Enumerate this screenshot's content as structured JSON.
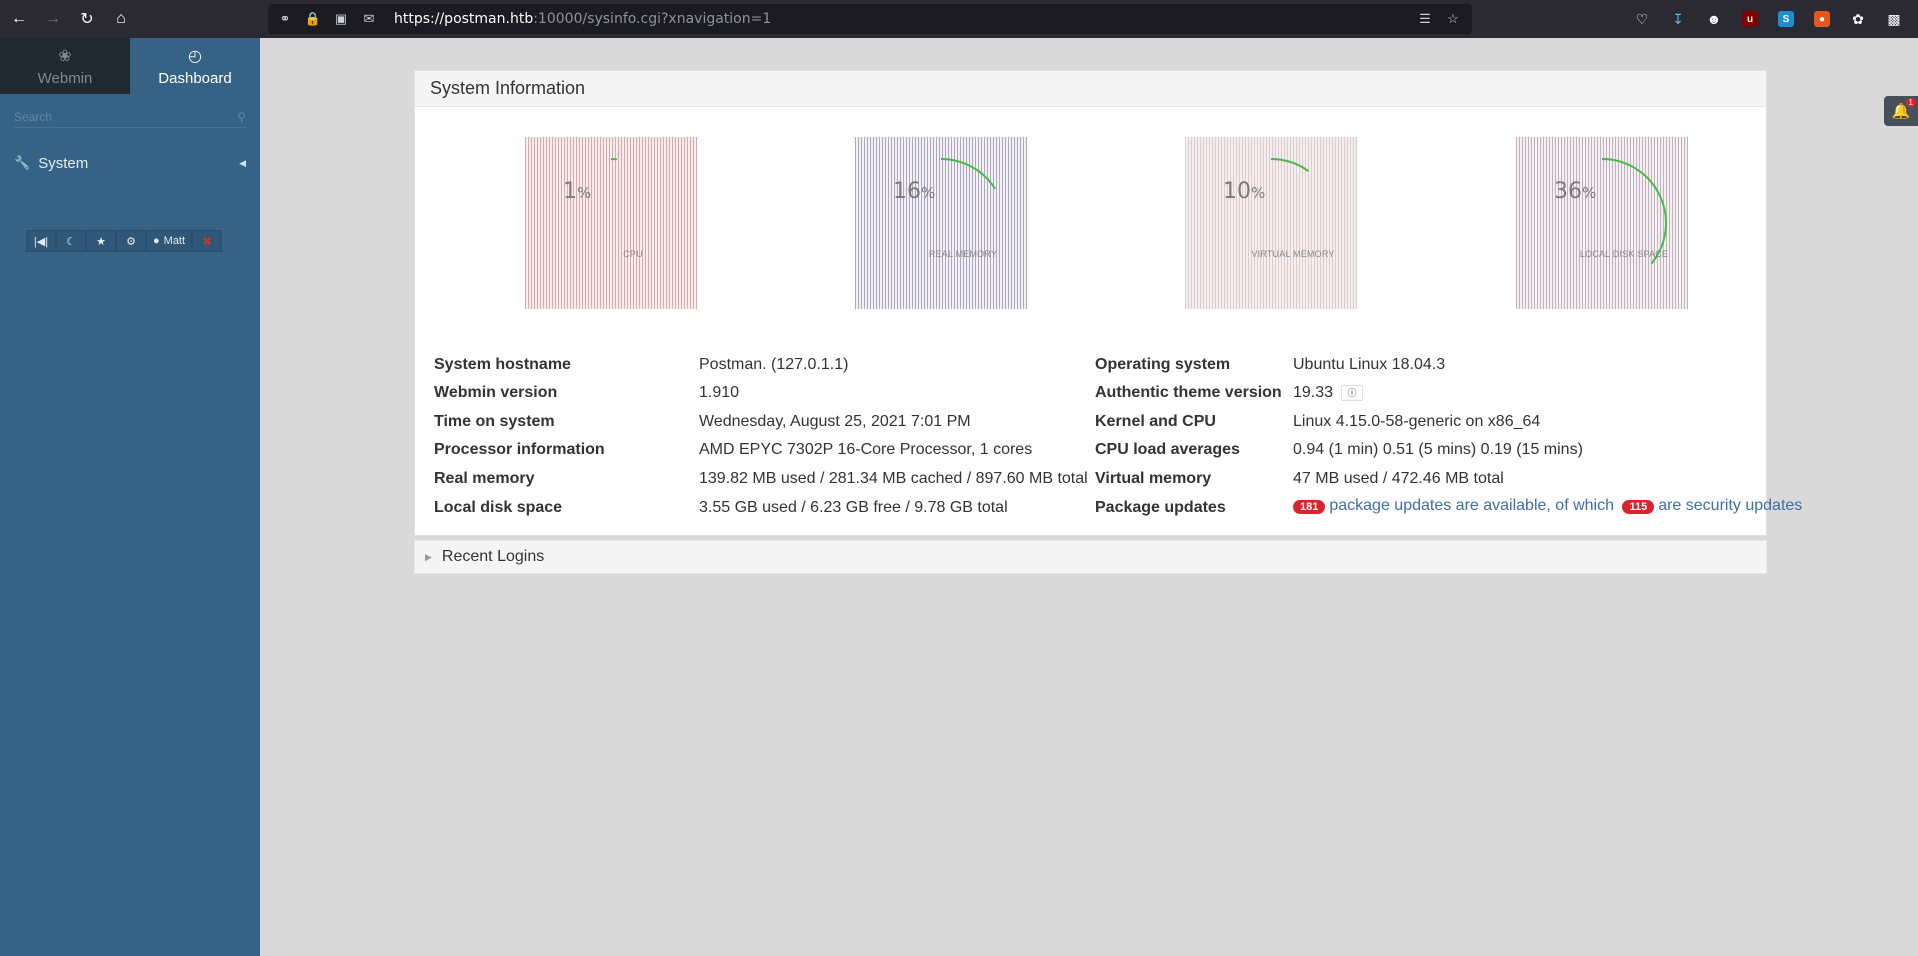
{
  "browser": {
    "url_host": "https://postman.htb",
    "url_rest": ":10000/sysinfo.cgi?xnavigation=1"
  },
  "sidebar": {
    "tabs": [
      {
        "label": "Webmin",
        "icon": "webmin-logo-icon"
      },
      {
        "label": "Dashboard",
        "icon": "dashboard-gauge-icon"
      }
    ],
    "search_placeholder": "Search",
    "menu_items": [
      {
        "label": "System",
        "icon": "wrench-icon"
      }
    ],
    "tools": {
      "user_label": "Matt"
    }
  },
  "system_info": {
    "title": "System Information",
    "gauges": [
      {
        "value": "1",
        "unit": "%",
        "label": "CPU",
        "percent": 1,
        "color": "#e8a3a3"
      },
      {
        "value": "16",
        "unit": "%",
        "label": "REAL MEMORY",
        "percent": 16,
        "color": "#a7a7c8"
      },
      {
        "value": "10",
        "unit": "%",
        "label": "VIRTUAL MEMORY",
        "percent": 10,
        "color": "#e2c7ce"
      },
      {
        "value": "36",
        "unit": "%",
        "label": "LOCAL DISK SPACE",
        "percent": 36,
        "color": "#c0b1c0"
      }
    ],
    "left": [
      {
        "key": "System hostname",
        "value": "Postman. (127.0.1.1)"
      },
      {
        "key": "Webmin version",
        "value": "1.910"
      },
      {
        "key": "Time on system",
        "value": "Wednesday, August 25, 2021 7:01 PM"
      },
      {
        "key": "Processor information",
        "value": "AMD EPYC 7302P 16-Core Processor, 1 cores"
      },
      {
        "key": "Real memory",
        "value": "139.82 MB used / 281.34 MB cached / 897.60 MB total"
      },
      {
        "key": "Local disk space",
        "value": "3.55 GB used / 6.23 GB free / 9.78 GB total"
      }
    ],
    "right": [
      {
        "key": "Operating system",
        "value": "Ubuntu Linux 18.04.3"
      },
      {
        "key": "Authentic theme version",
        "value": "19.33"
      },
      {
        "key": "Kernel and CPU",
        "value": "Linux 4.15.0-58-generic on x86_64"
      },
      {
        "key": "CPU load averages",
        "value": "0.94 (1 min) 0.51 (5 mins) 0.19 (15 mins)"
      },
      {
        "key": "Virtual memory",
        "value": "47 MB used / 472.46 MB total"
      },
      {
        "key": "Package updates",
        "value": ""
      }
    ],
    "package_updates": {
      "count": "181",
      "text1": "package updates are available, of which",
      "security_count": "115",
      "text2": "are security updates"
    }
  },
  "recent_logins": {
    "title": "Recent Logins"
  },
  "notifications": {
    "count": "1"
  }
}
